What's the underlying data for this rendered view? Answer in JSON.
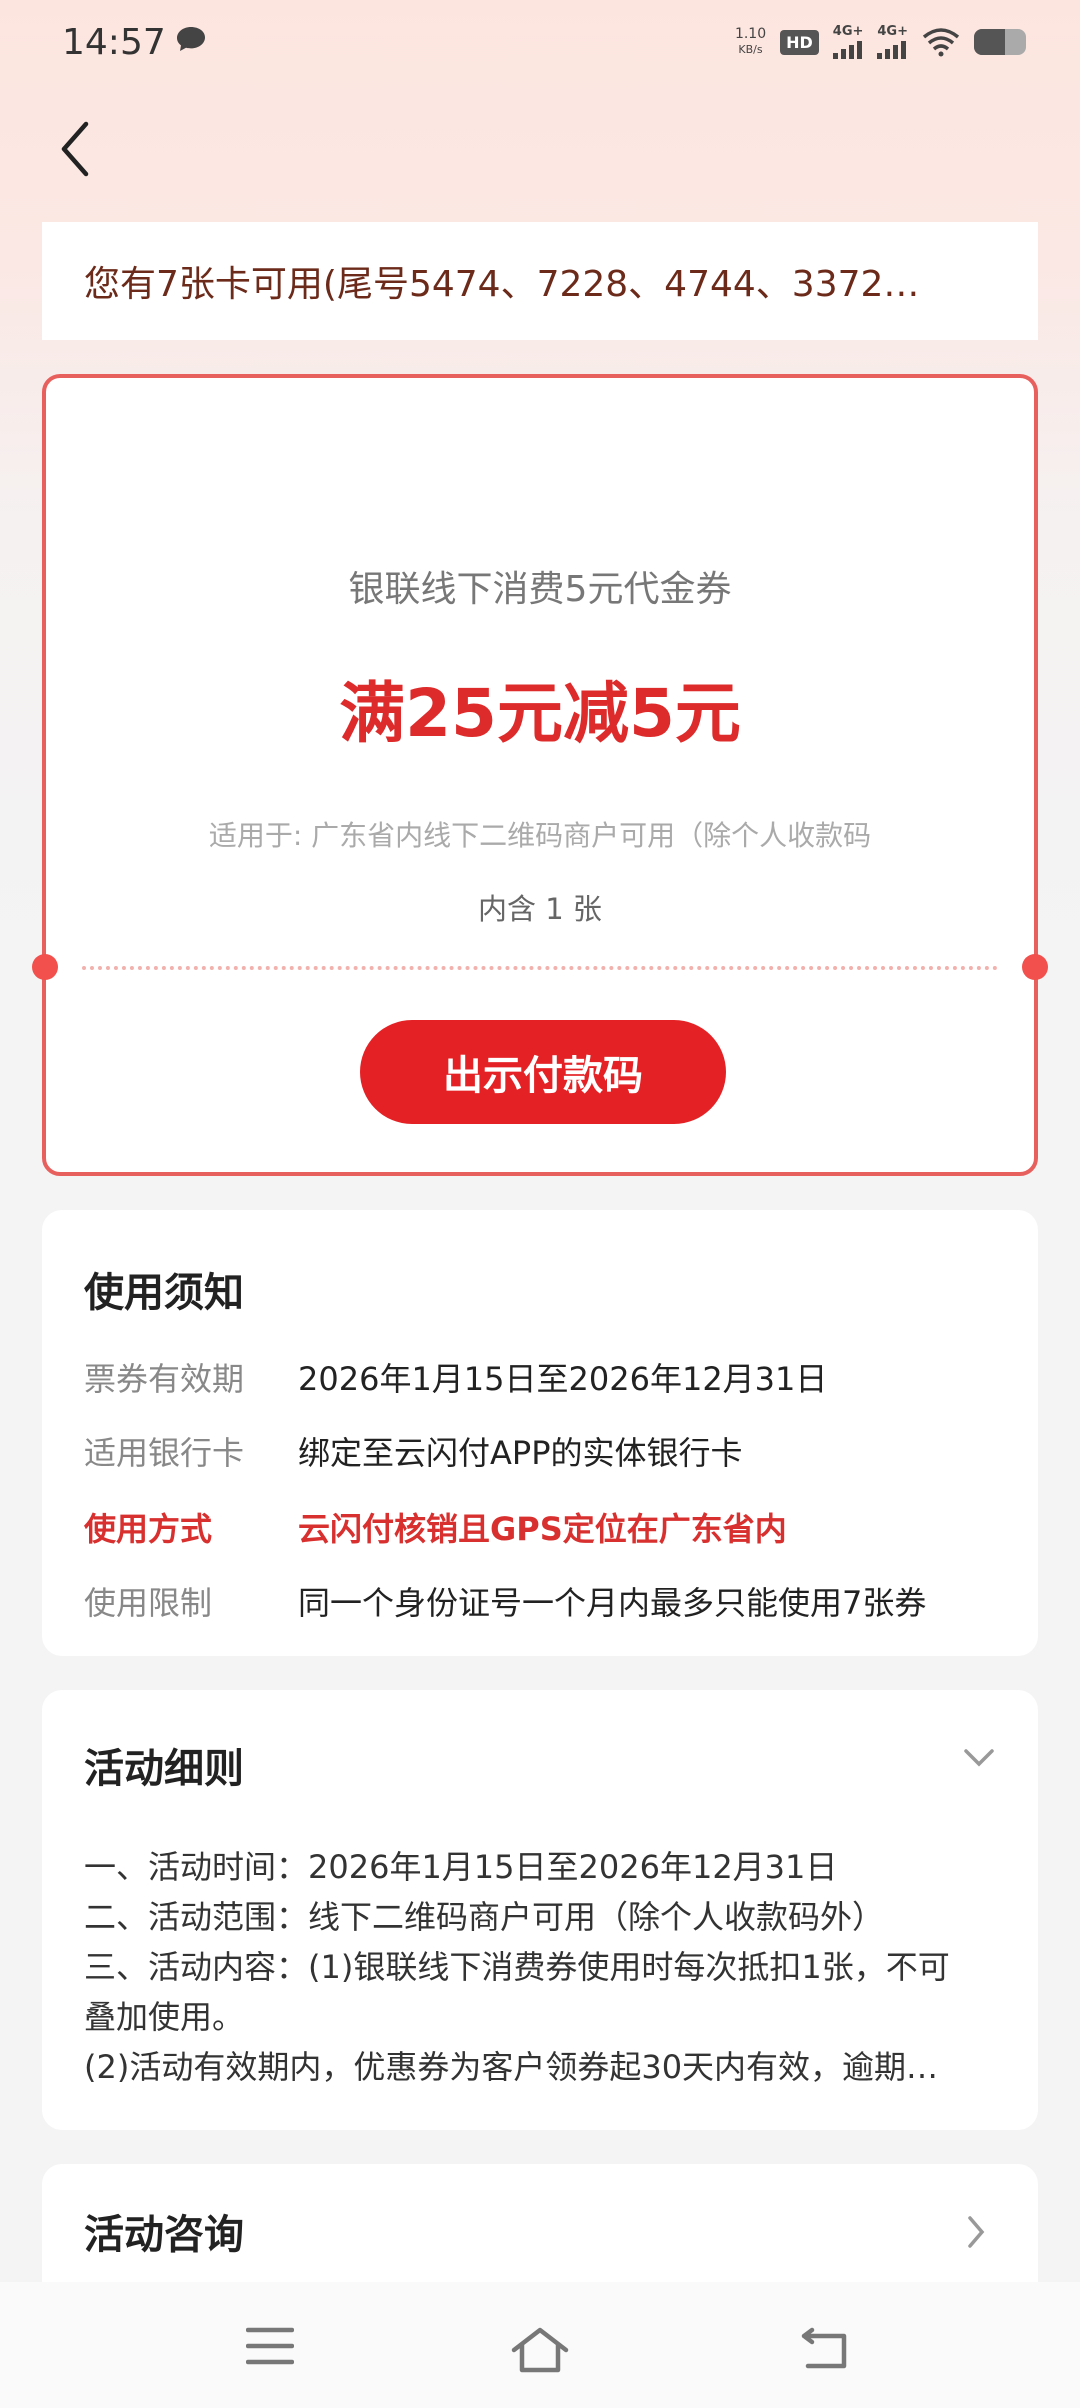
{
  "status_bar": {
    "time": "14:57",
    "net_speed_value": "1.10",
    "net_speed_unit": "KB/s",
    "hd_label": "HD",
    "signal_1_label": "4G+",
    "signal_2_label": "4G+",
    "battery_level": 0.6
  },
  "summary": {
    "text": "您有7张卡可用(尾号5474、7228、4744、3372…"
  },
  "coupon": {
    "title": "银联线下消费5元代金券",
    "value": "满25元减5元",
    "scope": "适用于: 广东省内线下二维码商户可用（除个人收款码",
    "count": "内含 1 张",
    "button": "出示付款码"
  },
  "notice": {
    "title": "使用须知",
    "rows": [
      {
        "key": "票券有效期",
        "value": "2026年1月15日至2026年12月31日"
      },
      {
        "key": "适用银行卡",
        "value": "绑定至云闪付APP的实体银行卡"
      },
      {
        "key": "使用方式",
        "value": "云闪付核销且GPS定位在广东省内"
      },
      {
        "key": "使用限制",
        "value": "同一个身份证号一个月内最多只能使用7张券"
      }
    ]
  },
  "rules": {
    "title": "活动细则",
    "lines": [
      "一、活动时间：2026年1月15日至2026年12月31日",
      "二、活动范围：线下二维码商户可用（除个人收款码外）",
      "三、活动内容：(1)银联线下消费券使用时每次抵扣1张，不可",
      "叠加使用。",
      "(2)活动有效期内，优惠券为客户领券起30天内有效，逾期…"
    ]
  },
  "consult": {
    "title": "活动咨询"
  },
  "colors": {
    "accent": "#e42226",
    "highlight": "#d8302f",
    "summary_text": "#6b2a1a"
  }
}
